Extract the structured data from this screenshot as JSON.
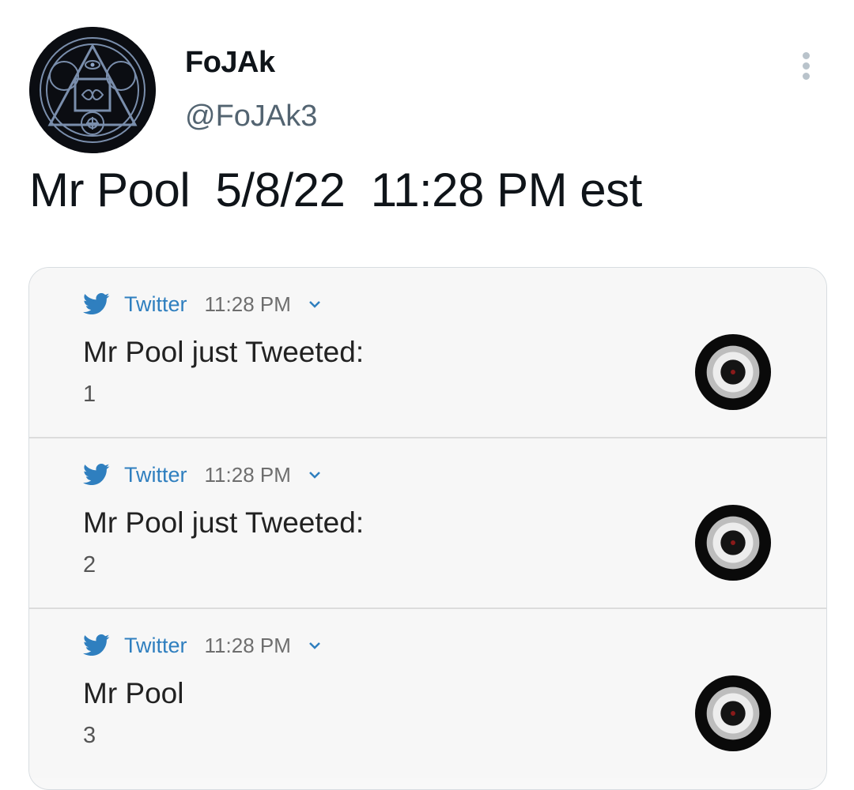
{
  "author": {
    "display_name": "FoJAk",
    "handle": "@FoJAk3",
    "avatar_icon": "sigil-avatar"
  },
  "more_icon": "more-vertical-icon",
  "tweet": {
    "text": "Mr Pool  5/8/22  11:28 PM est"
  },
  "notifications": [
    {
      "app": "Twitter",
      "time": "11:28 PM",
      "title": "Mr Pool just Tweeted:",
      "body": "1"
    },
    {
      "app": "Twitter",
      "time": "11:28 PM",
      "title": "Mr Pool just Tweeted:",
      "body": "2"
    },
    {
      "app": "Twitter",
      "time": "11:28 PM",
      "title": "Mr Pool",
      "body": "3"
    }
  ],
  "colors": {
    "twitter_blue": "#2f7fbf",
    "handle_gray": "#536471",
    "text_dark": "#0f1419"
  }
}
